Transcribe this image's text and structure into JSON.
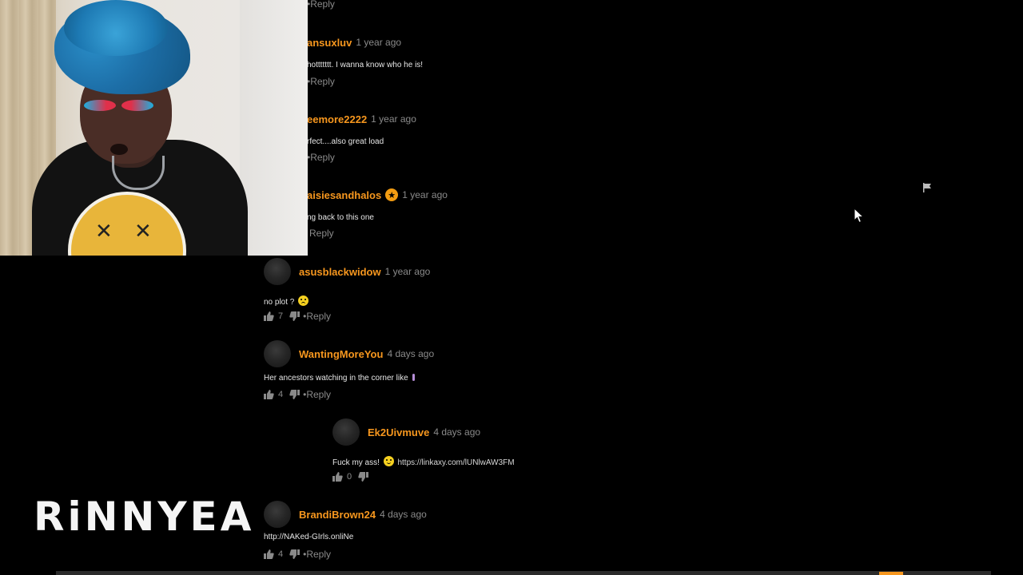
{
  "reply_label": "Reply",
  "comments": [
    {
      "username": "",
      "timestamp": "",
      "text": "",
      "reply": "Reply"
    },
    {
      "username": "ansuxluv",
      "timestamp": "1 year ago",
      "text": "hottttttt. I wanna know who he is!",
      "reply": "Reply"
    },
    {
      "username": "eemore2222",
      "timestamp": "1 year ago",
      "text": "rfect....also great load",
      "reply": "Reply"
    },
    {
      "username": "aisiesandhalos",
      "timestamp": "1 year ago",
      "text": "ng back to this one",
      "reply": "Reply",
      "badge": "★"
    },
    {
      "username": "asusblackwidow",
      "timestamp": "1 year ago",
      "text": "no plot ?",
      "likes": "7",
      "reply": "Reply"
    },
    {
      "username": "WantingMoreYou",
      "timestamp": "4 days ago",
      "text": "Her ancestors watching in the corner like",
      "likes": "4",
      "reply": "Reply"
    },
    {
      "username": "Ek2Uivmuve",
      "timestamp": "4 days ago",
      "text": "Fuck my ass!",
      "link": "https://linkaxy.com/lUNlwAW3FM",
      "likes": "0"
    },
    {
      "username": "BrandiBrown24",
      "timestamp": "4 days ago",
      "text": "http://NAKed-GIrls.onliNe",
      "likes": "4",
      "reply": "Reply"
    }
  ],
  "overlay": {
    "watermark": "RiNNYEA"
  },
  "icons": {
    "like": "thumbs-up-icon",
    "dislike": "thumbs-down-icon",
    "flag": "flag-icon",
    "cursor": "mouse-cursor-icon",
    "emoji_smile": "smile-emoji-icon",
    "emoji_sad": "sad-emoji-icon"
  },
  "colors": {
    "background": "#000000",
    "username": "#f7971e",
    "timestamp": "#8a8a8a",
    "text": "#e6e6e6"
  }
}
